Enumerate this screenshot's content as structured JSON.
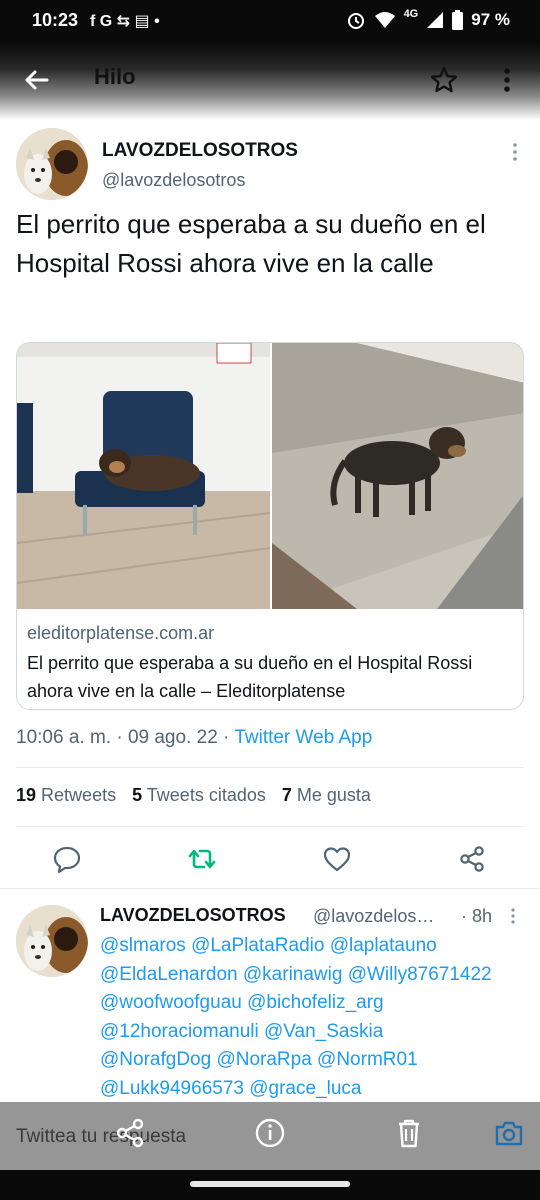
{
  "status_bar": {
    "time": "10:23",
    "left_icons": [
      "facebook-icon",
      "google-icon",
      "retweet-icon",
      "news-icon",
      "dot-icon"
    ],
    "left_glyphs": "f G ⇆ ▤ •",
    "network": "4G",
    "battery": "97 %"
  },
  "header": {
    "title": "Hilo"
  },
  "tweet": {
    "display_name": "LAVOZDELOSOTROS",
    "handle": "@lavozdelosotros",
    "text": "El perrito que esperaba a su dueño en el Hospital Rossi ahora vive en la calle",
    "card": {
      "domain": "eleditorplatense.com.ar",
      "title": "El perrito que esperaba a su dueño en el Hospital Rossi ahora vive en la calle – Eleditorplatense"
    },
    "time": "10:06 a. m.",
    "sep": " · ",
    "date": "09 ago. 22",
    "app": "Twitter Web App",
    "stats": [
      {
        "count": "19",
        "label": "Retweets"
      },
      {
        "count": "5",
        "label": "Tweets citados"
      },
      {
        "count": "7",
        "label": "Me gusta"
      }
    ],
    "colors": {
      "accent": "#1d9bf0",
      "retweet": "#00ba7c",
      "secondary": "#536471"
    }
  },
  "reply": {
    "display_name": "LAVOZDELOSOTROS",
    "handle": "@lavozdelos…",
    "time": "· 8h",
    "mentions_lines": [
      "@slmaros @LaPlataRadio @laplatauno",
      "@EldaLenardon @karinawig @Willy87671422",
      "@woofwoofguau @bichofeliz_arg",
      "@12horaciomanuli @Van_Saskia",
      "@NorafgDog @NoraRpa @NormR01",
      "@Lukk94966573 @grace_luca"
    ]
  },
  "composer": {
    "placeholder": "Twittea tu respuesta"
  }
}
